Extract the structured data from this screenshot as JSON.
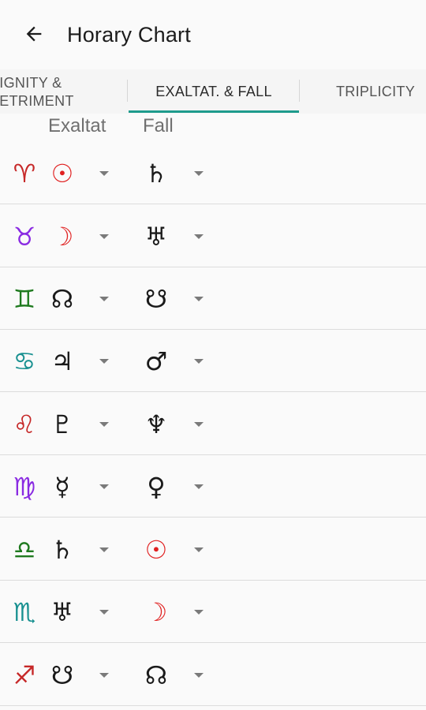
{
  "app_bar": {
    "title": "Horary Chart",
    "back_icon": "arrow-left-icon"
  },
  "tabs": [
    {
      "line1": "DIGNITY &",
      "line2": "DETRIMENT",
      "selected": false
    },
    {
      "label": "EXALTAT. & FALL",
      "selected": true
    },
    {
      "label": "TRIPLICITY",
      "selected": false
    }
  ],
  "colors": {
    "accent": "#1e9b8c",
    "red": "#e02020",
    "purple": "#8a2be2",
    "green": "#1f7a1f",
    "teal": "#1a9191",
    "dark_red": "#b01818",
    "black": "#1a1a1a"
  },
  "columns": {
    "exaltation": "Exaltat",
    "fall": "Fall"
  },
  "rows": [
    {
      "sign": "♈",
      "sign_name": "aries",
      "sign_color": "#c62828",
      "exalt": "☉",
      "exalt_name": "sun",
      "exalt_color": "#e02020",
      "fall": "♄",
      "fall_name": "saturn",
      "fall_color": "#1a1a1a"
    },
    {
      "sign": "♉",
      "sign_name": "taurus",
      "sign_color": "#8a2be2",
      "exalt": "☽",
      "exalt_name": "moon",
      "exalt_color": "#e02020",
      "fall": "♅",
      "fall_name": "uranus",
      "fall_color": "#1a1a1a"
    },
    {
      "sign": "♊",
      "sign_name": "gemini",
      "sign_color": "#1f7a1f",
      "exalt": "☊",
      "exalt_name": "north-node",
      "exalt_color": "#1a1a1a",
      "fall": "☋",
      "fall_name": "south-node",
      "fall_color": "#1a1a1a"
    },
    {
      "sign": "♋",
      "sign_name": "cancer",
      "sign_color": "#1a9191",
      "exalt": "♃",
      "exalt_name": "jupiter",
      "exalt_color": "#1a1a1a",
      "fall": "♂",
      "fall_name": "mars",
      "fall_color": "#1a1a1a"
    },
    {
      "sign": "♌",
      "sign_name": "leo",
      "sign_color": "#c62828",
      "exalt": "♇",
      "exalt_name": "pluto",
      "exalt_color": "#1a1a1a",
      "fall": "♆",
      "fall_name": "neptune",
      "fall_color": "#1a1a1a"
    },
    {
      "sign": "♍",
      "sign_name": "virgo",
      "sign_color": "#8a2be2",
      "exalt": "☿",
      "exalt_name": "mercury",
      "exalt_color": "#1a1a1a",
      "fall": "♀",
      "fall_name": "venus",
      "fall_color": "#1a1a1a"
    },
    {
      "sign": "♎",
      "sign_name": "libra",
      "sign_color": "#1f7a1f",
      "exalt": "♄",
      "exalt_name": "saturn",
      "exalt_color": "#1a1a1a",
      "fall": "☉",
      "fall_name": "sun",
      "fall_color": "#e02020"
    },
    {
      "sign": "♏",
      "sign_name": "scorpio",
      "sign_color": "#1a9191",
      "exalt": "♅",
      "exalt_name": "uranus",
      "exalt_color": "#1a1a1a",
      "fall": "☽",
      "fall_name": "moon",
      "fall_color": "#e02020"
    },
    {
      "sign": "♐",
      "sign_name": "sagittarius",
      "sign_color": "#c62828",
      "exalt": "☋",
      "exalt_name": "south-node",
      "exalt_color": "#1a1a1a",
      "fall": "☊",
      "fall_name": "north-node",
      "fall_color": "#1a1a1a"
    }
  ]
}
